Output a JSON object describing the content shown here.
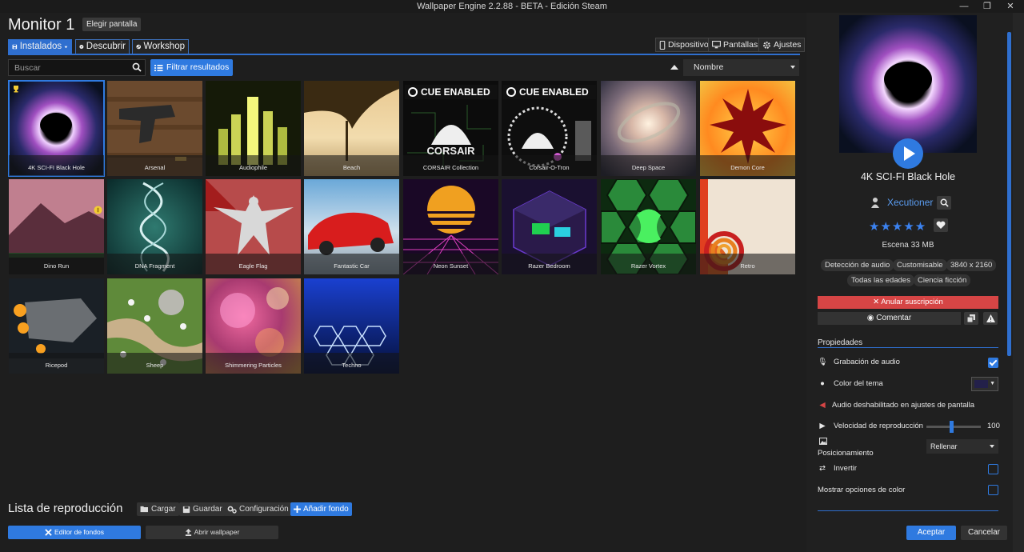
{
  "window": {
    "title": "Wallpaper Engine 2.2.88 - BETA - Edición Steam",
    "minimize": "—",
    "restore": "❐",
    "close": "✕"
  },
  "header": {
    "monitor_title": "Monitor 1",
    "choose_screen": "Elegir pantalla"
  },
  "tabs": [
    {
      "label": "Instalados",
      "active": true
    },
    {
      "label": "Descubrir",
      "active": false
    },
    {
      "label": "Workshop",
      "active": false
    }
  ],
  "right_tabs": {
    "device": "Dispositivo",
    "screens": "Pantallas",
    "settings": "Ajustes"
  },
  "search": {
    "placeholder": "Buscar",
    "value": ""
  },
  "filter": {
    "label": "Filtrar resultados"
  },
  "sort": {
    "value": "Nombre"
  },
  "wallpapers": [
    {
      "name": "4K SCI-FI Black Hole",
      "selected": true,
      "badge": "trophy"
    },
    {
      "name": "Arsenal"
    },
    {
      "name": "Audiophile"
    },
    {
      "name": "Beach"
    },
    {
      "name": "CORSAIR Collection",
      "overlay": "CUE ENABLED",
      "logo": "CORSAIR"
    },
    {
      "name": "Corsair-O-Tron",
      "overlay": "CUE ENABLED"
    },
    {
      "name": "Deep Space"
    },
    {
      "name": "Demon Core"
    },
    {
      "name": "Dino Run",
      "badge": "coin"
    },
    {
      "name": "DNA Fragment"
    },
    {
      "name": "Eagle Flag"
    },
    {
      "name": "Fantastic Car"
    },
    {
      "name": "Neon Sunset"
    },
    {
      "name": "Razer Bedroom"
    },
    {
      "name": "Razer Vortex"
    },
    {
      "name": "Retro"
    },
    {
      "name": "Ricepod"
    },
    {
      "name": "Sheep"
    },
    {
      "name": "Shimmering Particles"
    },
    {
      "name": "Techno"
    }
  ],
  "playlist": {
    "title": "Lista de reproducción",
    "load": "Cargar",
    "save": "Guardar",
    "config": "Configuración",
    "add": "Añadir fondo"
  },
  "bottom": {
    "editor": "Editor de fondos",
    "open": "Abrir wallpaper"
  },
  "details": {
    "title": "4K SCI-FI Black Hole",
    "author": "Xecutioner",
    "rating": 5,
    "stars": "★★★★★",
    "meta": "Escena  33 MB",
    "tags": [
      "Detección de audio",
      "Customisable",
      "3840 x 2160",
      "Todas las edades",
      "Ciencia ficción"
    ],
    "unsubscribe": "Anular suscripción",
    "comment": "Comentar"
  },
  "properties": {
    "title": "Propiedades",
    "audio_recording": {
      "label": "Grabación de audio",
      "checked": true
    },
    "theme_color": {
      "label": "Color del tema",
      "color": "#23204a"
    },
    "audio_disabled": "Audio deshabilitado en ajustes de pantalla",
    "speed": {
      "label": "Velocidad de reproducción",
      "value": "100",
      "fraction": 0.45
    },
    "positioning": {
      "label": "Posicionamiento",
      "value": "Rellenar"
    },
    "invert": {
      "label": "Invertir",
      "checked": false
    },
    "color_options": {
      "label": "Mostrar opciones de color",
      "checked": false
    }
  },
  "actions": {
    "accept": "Aceptar",
    "cancel": "Cancelar"
  },
  "colors": {
    "accent": "#2f7ae0",
    "danger": "#d64545",
    "author": "#5a9cf0"
  }
}
